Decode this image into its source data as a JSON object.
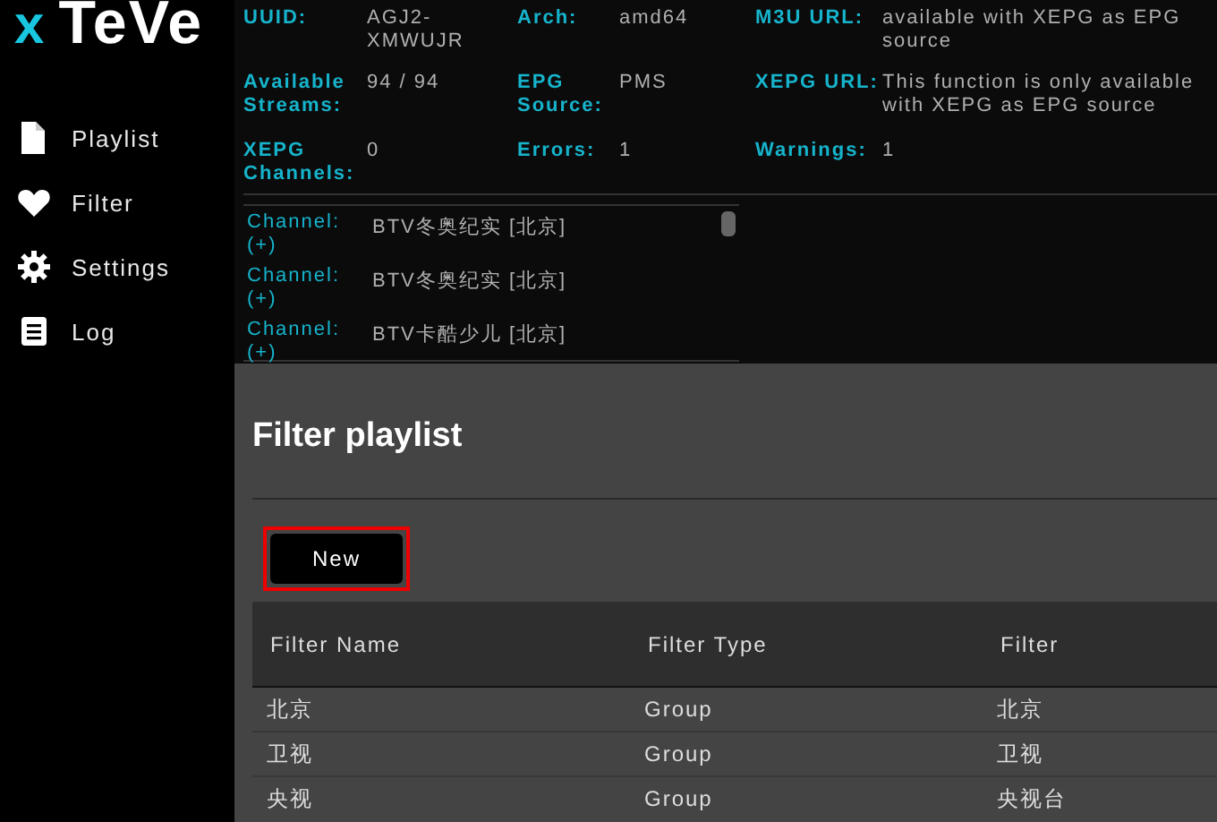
{
  "logo": {
    "mark": "x",
    "text": "TeVe"
  },
  "sidebar": {
    "items": [
      {
        "label": "Playlist"
      },
      {
        "label": "Filter"
      },
      {
        "label": "Settings"
      },
      {
        "label": "Log"
      }
    ]
  },
  "stats": [
    {
      "label": "UUID:",
      "value": "AGJ2-XMWUJR"
    },
    {
      "label": "Arch:",
      "value": "amd64"
    },
    {
      "label": "M3U URL:",
      "value": "available with XEPG as EPG source"
    },
    {
      "label": "Available Streams:",
      "value": "94 / 94"
    },
    {
      "label": "EPG Source:",
      "value": "PMS"
    },
    {
      "label": "XEPG URL:",
      "value": "This function is only available with XEPG as EPG source"
    },
    {
      "label": "XEPG Channels:",
      "value": "0"
    },
    {
      "label": "Errors:",
      "value": "1"
    },
    {
      "label": "Warnings:",
      "value": "1"
    }
  ],
  "channel_log": [
    {
      "label": "Channel: (+)",
      "value": "BTV冬奥纪实 [北京]"
    },
    {
      "label": "Channel: (+)",
      "value": "BTV冬奥纪实 [北京]"
    },
    {
      "label": "Channel: (+)",
      "value": "BTV卡酷少儿 [北京]"
    }
  ],
  "dialog": {
    "title": "Filter playlist",
    "new_button": "New",
    "table": {
      "columns": [
        "Filter Name",
        "Filter Type",
        "Filter"
      ],
      "rows": [
        [
          "北京",
          "Group",
          "北京"
        ],
        [
          "卫视",
          "Group",
          "卫视"
        ],
        [
          "央视",
          "Group",
          "央视台"
        ]
      ]
    }
  }
}
